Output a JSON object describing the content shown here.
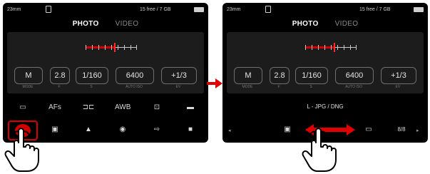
{
  "colors": {
    "screen_bg": "#000000",
    "panel_bg": "#1c1c1c",
    "accent_red": "#d80000",
    "text": "#e4e4e4",
    "muted": "#8a8a8a"
  },
  "status": {
    "exposures": "23mm",
    "storage": "15 free / 7 GB"
  },
  "tabs": {
    "photo": "PHOTO",
    "video": "VIDEO"
  },
  "exposure_params": [
    {
      "value": "M",
      "label": "MODE"
    },
    {
      "value": "2.8",
      "label": "F"
    },
    {
      "value": "1/160",
      "label": "S"
    },
    {
      "value": "6400",
      "label": "AUTO ISO"
    },
    {
      "value": "+1/3",
      "label": "EV"
    }
  ],
  "left_menu_row1": [
    "rect-icon",
    "AFs",
    "drive-mode-icon",
    "AWB",
    "focus-frame-icon",
    "grid-icon"
  ],
  "left_menu_row1_text": {
    "af": "AFs",
    "wb": "AWB"
  },
  "left_menu_row2": [
    "record-icon",
    "card-icon",
    "upload-icon",
    "circle-icon",
    "export-icon",
    "square-icon"
  ],
  "right_submenu": {
    "current_value": "L - JPG / DNG",
    "items": [
      "card-icon",
      "record-icon",
      "panel-icon"
    ],
    "last_item": "8/8"
  }
}
